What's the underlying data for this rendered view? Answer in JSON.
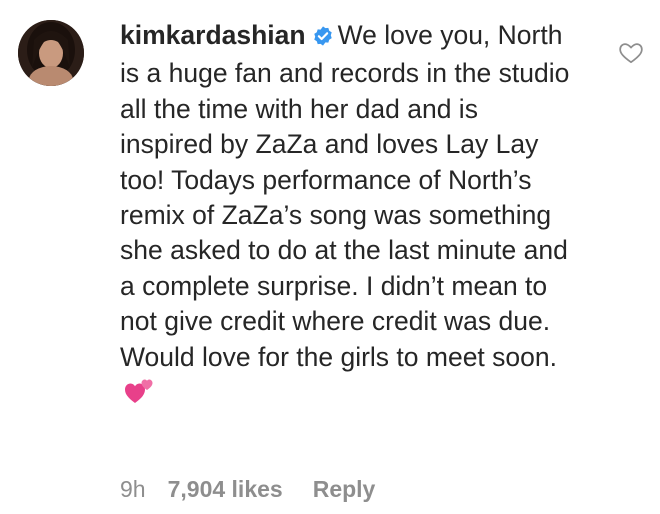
{
  "comment": {
    "username": "kimkardashian",
    "verified": true,
    "text": "We love you, North is a huge fan and records in the studio all the time with her dad and is inspired by ZaZa and loves Lay Lay too! Todays performance of North’s remix of ZaZa’s song was something she asked to do at the last minute and a complete surprise. I didn’t mean to not give credit where credit was due. Would love for the girls to meet soon.",
    "emoji": "two-hearts-emoji",
    "time": "9h",
    "likes": "7,904 likes",
    "reply_label": "Reply"
  },
  "icons": {
    "verified": "verified-badge-icon",
    "like": "heart-outline-icon"
  },
  "colors": {
    "text": "#262626",
    "muted": "#8e8e8e",
    "verified_blue": "#3897f0",
    "emoji_pink": "#e8408a"
  }
}
